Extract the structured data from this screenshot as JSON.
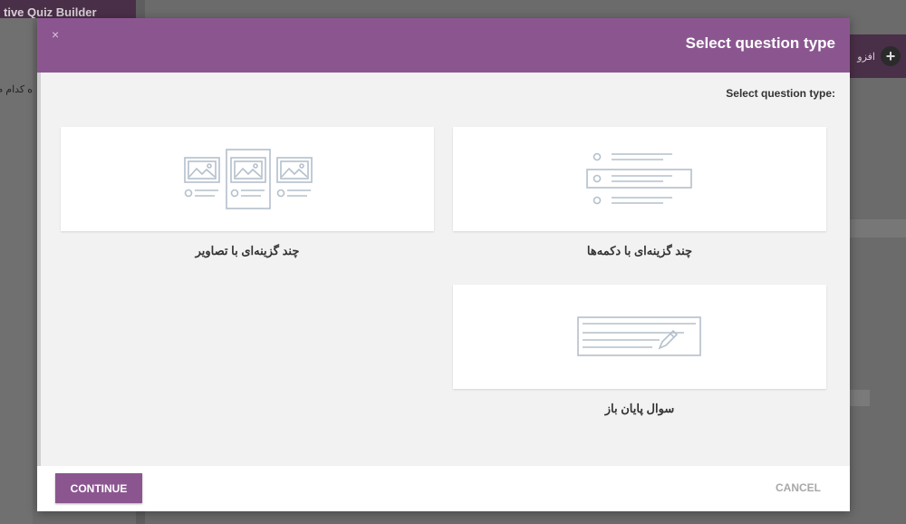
{
  "background": {
    "app_title": "tive Quiz Builder",
    "left_text": "ه کدام م",
    "add_label": "افزو"
  },
  "modal": {
    "title": "Select question type",
    "section_label": "Select question type:",
    "close_symbol": "×",
    "types": [
      {
        "label": "چند گزینه‌ای با دکمه‌ها",
        "icon": "radio-list-icon"
      },
      {
        "label": "چند گزینه‌ای با تصاویر",
        "icon": "image-options-icon"
      },
      {
        "label": "سوال پایان باز",
        "icon": "text-area-pencil-icon"
      }
    ],
    "continue_label": "CONTINUE",
    "cancel_label": "CANCEL"
  },
  "colors": {
    "header": "#8b5690",
    "icon_stroke": "#b4c0cb"
  }
}
